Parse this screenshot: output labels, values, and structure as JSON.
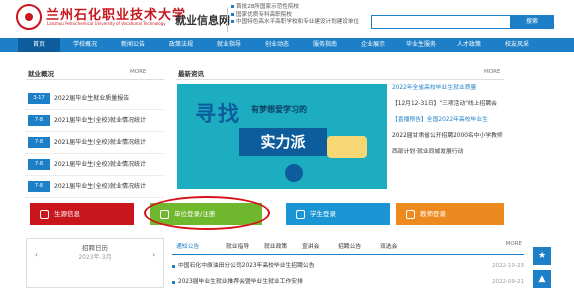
{
  "header": {
    "logo_cn": "兰州石化职业技术大学",
    "logo_en": "Lanzhou Petrochemical University of Vocational Technology",
    "site_name": "就业信息网",
    "notices": [
      "首批28所国家示范性院校",
      "国家优质专科高职院校",
      "中国特色高水平高职学校和专业建设计划建设单位"
    ],
    "search_button": "搜索"
  },
  "nav": [
    {
      "label": "首页",
      "active": true
    },
    {
      "label": "学校概况",
      "active": false
    },
    {
      "label": "新闻公告",
      "active": false
    },
    {
      "label": "政策法规",
      "active": false
    },
    {
      "label": "就业指导",
      "active": false
    },
    {
      "label": "创业动态",
      "active": false
    },
    {
      "label": "服务指南",
      "active": false
    },
    {
      "label": "企业展示",
      "active": false
    },
    {
      "label": "毕业生服务",
      "active": false
    },
    {
      "label": "人才政策",
      "active": false
    },
    {
      "label": "校友风采",
      "active": false
    }
  ],
  "employment_overview": {
    "title": "就业概况",
    "more": "MORE",
    "items": [
      {
        "date": "3-17",
        "title": "2022届毕业生就业质量报告"
      },
      {
        "date": "7-8",
        "title": "2021届毕业生(全校)就业情况统计"
      },
      {
        "date": "7-8",
        "title": "2021届毕业生(全校)就业情况统计"
      },
      {
        "date": "7-8",
        "title": "2021届毕业生(全校)就业情况统计"
      },
      {
        "date": "7-8",
        "title": "2021届毕业生(全校)就业情况统计"
      }
    ]
  },
  "latest_news": {
    "title": "最新资讯",
    "more": "MORE",
    "banner": {
      "headline": "寻找",
      "subline": "有梦想爱学习的",
      "boxed": "实力派"
    },
    "items": [
      {
        "text": "2022年全省高校毕业生就业质量",
        "style": "link"
      },
      {
        "text": "【12月12-31日】\"三项活动\"线上招聘会",
        "style": "dark"
      },
      {
        "text": "【直播预告】全国2022年高校毕业生",
        "style": "link"
      },
      {
        "text": "2022届甘肃省公开招聘2000名中小学教师",
        "style": "dark"
      },
      {
        "text": "西部计划·就业同城发展行动",
        "style": "dark"
      }
    ]
  },
  "quick_links": [
    {
      "label": "生源信息",
      "color": "#c9161d"
    },
    {
      "label": "单位登录/注册",
      "color": "#6fb82d"
    },
    {
      "label": "学生登录",
      "color": "#1c95d4"
    },
    {
      "label": "教师登录",
      "color": "#ec8a1f"
    }
  ],
  "calendar": {
    "title": "招聘日历",
    "month": "2023年-3月",
    "prev": "‹",
    "next": "›"
  },
  "tabs": {
    "items": [
      {
        "label": "通知公告",
        "active": true
      },
      {
        "label": "就业指导",
        "active": false
      },
      {
        "label": "就业政策",
        "active": false
      },
      {
        "label": "宣讲会",
        "active": false
      },
      {
        "label": "招聘公告",
        "active": false
      },
      {
        "label": "双选会",
        "active": false
      }
    ],
    "more": "MORE"
  },
  "list": [
    {
      "text": "中国石化中原油田分公司2023年高校毕业生招聘公告",
      "date": "2022-10-23"
    },
    {
      "text": "2023届毕业生就业推荐会暨毕业生就业工作安排",
      "date": "2022-09-21"
    }
  ],
  "side_buttons": [
    "★",
    "▲"
  ]
}
